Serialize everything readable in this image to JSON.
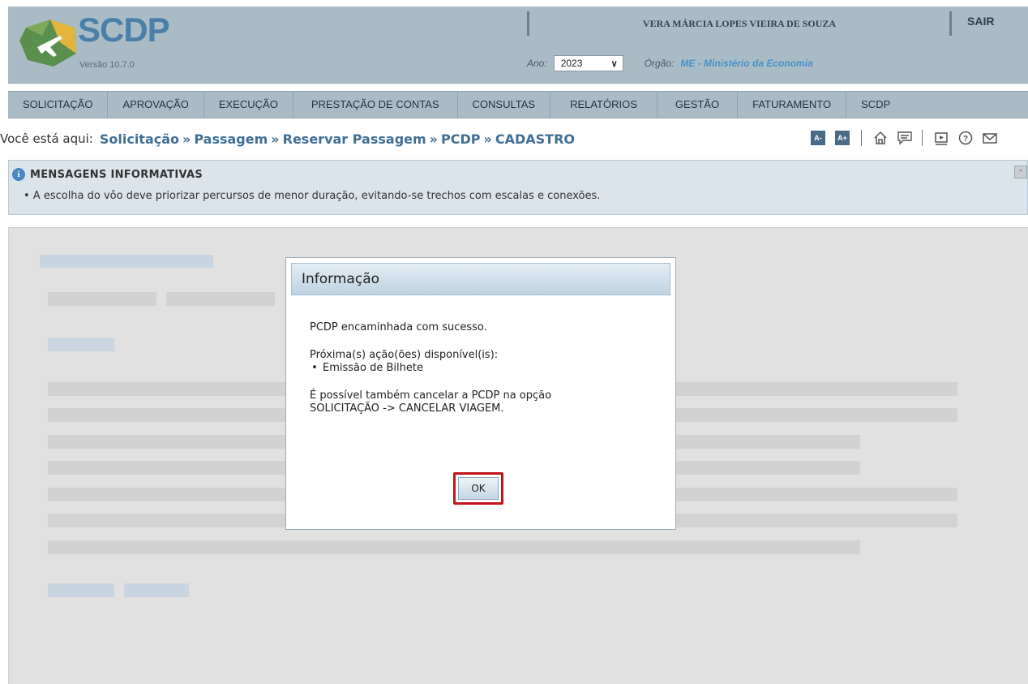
{
  "header": {
    "app_name": "SCDP",
    "version": "Versão 10.7.0",
    "user_name": "VERA MÁRCIA LOPES VIEIRA DE SOUZA",
    "exit_label": "SAIR",
    "year_label": "Ano:",
    "year_value": "2023",
    "org_label": "Órgão:",
    "org_value": "ME - Ministério da Economia"
  },
  "nav": {
    "items": [
      "SOLICITAÇÃO",
      "APROVAÇÃO",
      "EXECUÇÃO",
      "PRESTAÇÃO DE CONTAS",
      "CONSULTAS",
      "RELATÓRIOS",
      "GESTÃO",
      "FATURAMENTO",
      "SCDP"
    ]
  },
  "breadcrumb": {
    "lead": "Você está aqui:",
    "items": [
      "Solicitação",
      "Passagem",
      "Reservar Passagem",
      "PCDP",
      "CADASTRO"
    ],
    "separator": "»"
  },
  "toolbar": {
    "font_decrease": "A-",
    "font_increase": "A+",
    "icons": [
      "home-icon",
      "chat-icon",
      "video-icon",
      "help-icon",
      "mail-icon"
    ]
  },
  "messages": {
    "title": "MENSAGENS INFORMATIVAS",
    "text": "•  A escolha do vôo deve priorizar percursos de menor duração, evitando-se trechos com escalas e conexões.",
    "collapse": "-"
  },
  "dialog": {
    "title": "Informação",
    "line1": "PCDP encaminhada com sucesso.",
    "line2": "Próxima(s) ação(ões) disponível(is):",
    "bullet": "•",
    "bullet_item": "Emissão de Bilhete",
    "line3": "É possível também cancelar a PCDP na opção",
    "line4": "SOLICITAÇÃO -> CANCELAR VIAGEM.",
    "ok_label": "OK"
  },
  "colors": {
    "header_bg": "#a9bcc6",
    "brand_blue": "#4b7fa8",
    "highlight_red": "#c0151b"
  }
}
